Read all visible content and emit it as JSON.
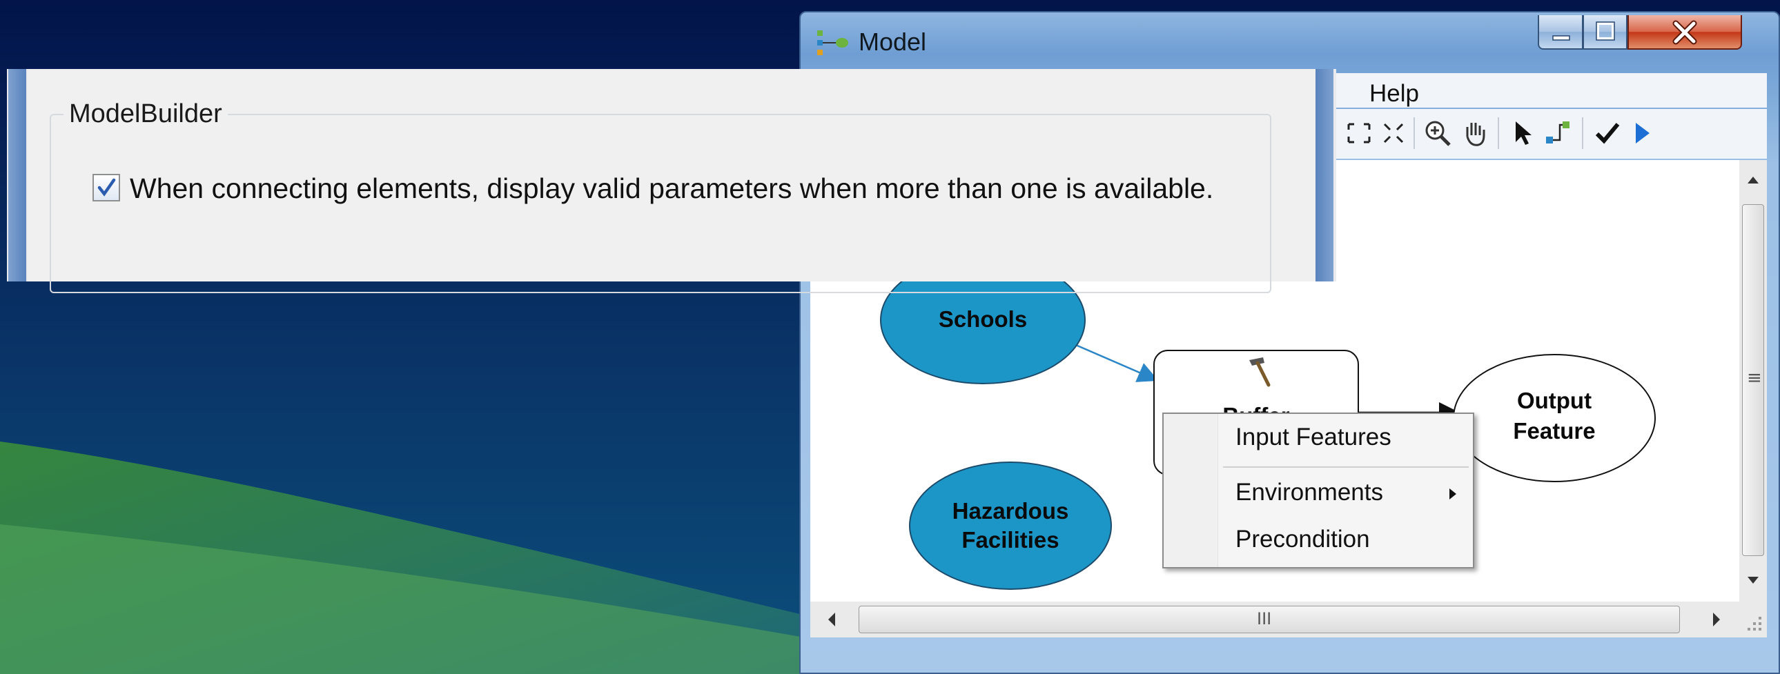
{
  "window": {
    "title": "Model",
    "menu": {
      "help_label": "Help"
    },
    "toolbar_icons": [
      "zoom-to-fit-icon",
      "full-extent-icon",
      "zoom-in-icon",
      "pan-icon",
      "select-icon",
      "connect-icon",
      "validate-icon",
      "run-icon"
    ]
  },
  "model": {
    "nodes": {
      "schools": "Schools",
      "buffer": "Buffer",
      "output": [
        "Output",
        "Feature"
      ],
      "hazardous": [
        "Hazardous",
        "Facilities"
      ]
    },
    "colors": {
      "input_fill": "#1c96c7",
      "output_fill": "#ffffff",
      "connector": "#2b86c8"
    }
  },
  "context_menu": {
    "items": [
      "Input Features",
      "Environments",
      "Precondition"
    ]
  },
  "options": {
    "group_title": "ModelBuilder",
    "checkbox_label": "When connecting elements, display valid parameters when more than one is available.",
    "checkbox_checked": true
  },
  "scrollbars": {
    "h_grip_label": "III",
    "v_grip_label": "≡"
  }
}
